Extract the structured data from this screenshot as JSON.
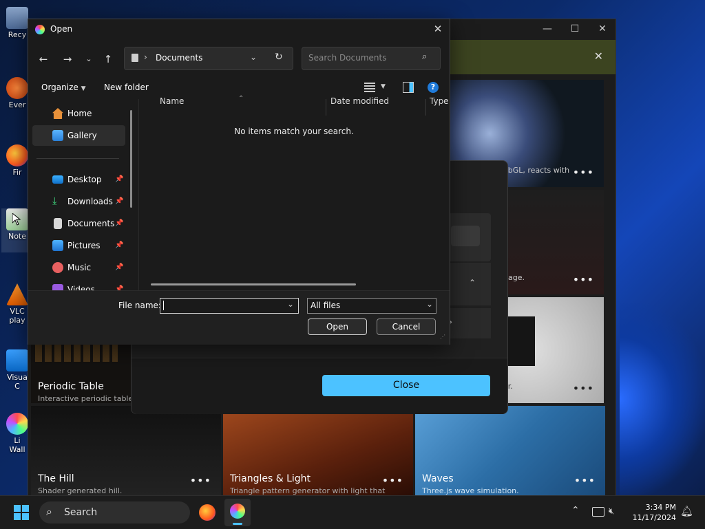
{
  "desktop": {
    "icons": [
      {
        "label": "Recy"
      },
      {
        "label": "Ever"
      },
      {
        "label": "Fir"
      },
      {
        "label": "Note"
      },
      {
        "label": "VLC\nplay"
      },
      {
        "label": "Visua\nC"
      },
      {
        "label": "Li\nWall"
      }
    ]
  },
  "background_app": {
    "notification_close": "✕",
    "cards": [
      {
        "title": "",
        "desc": "ebGL, reacts with"
      },
      {
        "title": "",
        "desc": "page."
      },
      {
        "title": "",
        "desc": "er."
      },
      {
        "title": "Periodic Table",
        "desc": "Interactive periodic table o"
      },
      {
        "title": "The Hill",
        "desc": "Shader generated hill."
      },
      {
        "title": "Triangles & Light",
        "desc": "Triangle pattern generator with light that"
      },
      {
        "title": "Waves",
        "desc": "Three.js wave simulation."
      }
    ],
    "dots": "•••"
  },
  "mid_dialog": {
    "close_label": "Close"
  },
  "open_dialog": {
    "title": "Open",
    "address": "Documents",
    "search_placeholder": "Search Documents",
    "organize_label": "Organize",
    "new_folder_label": "New folder",
    "columns": {
      "name": "Name",
      "date": "Date modified",
      "type": "Type"
    },
    "empty_message": "No items match your search.",
    "sidebar": [
      {
        "label": "Home"
      },
      {
        "label": "Gallery"
      },
      {
        "label": "Desktop"
      },
      {
        "label": "Downloads"
      },
      {
        "label": "Documents"
      },
      {
        "label": "Pictures"
      },
      {
        "label": "Music"
      },
      {
        "label": "Videos"
      }
    ],
    "file_name_label": "File name:",
    "file_name_value": "",
    "file_type": "All files",
    "open_label": "Open",
    "cancel_label": "Cancel"
  },
  "taskbar": {
    "search_label": "Search",
    "time": "3:34 PM",
    "date": "11/17/2024"
  },
  "colors": {
    "accent": "#60cdff",
    "close_button": "#4cc2ff",
    "selected": "#2d2d2d"
  }
}
